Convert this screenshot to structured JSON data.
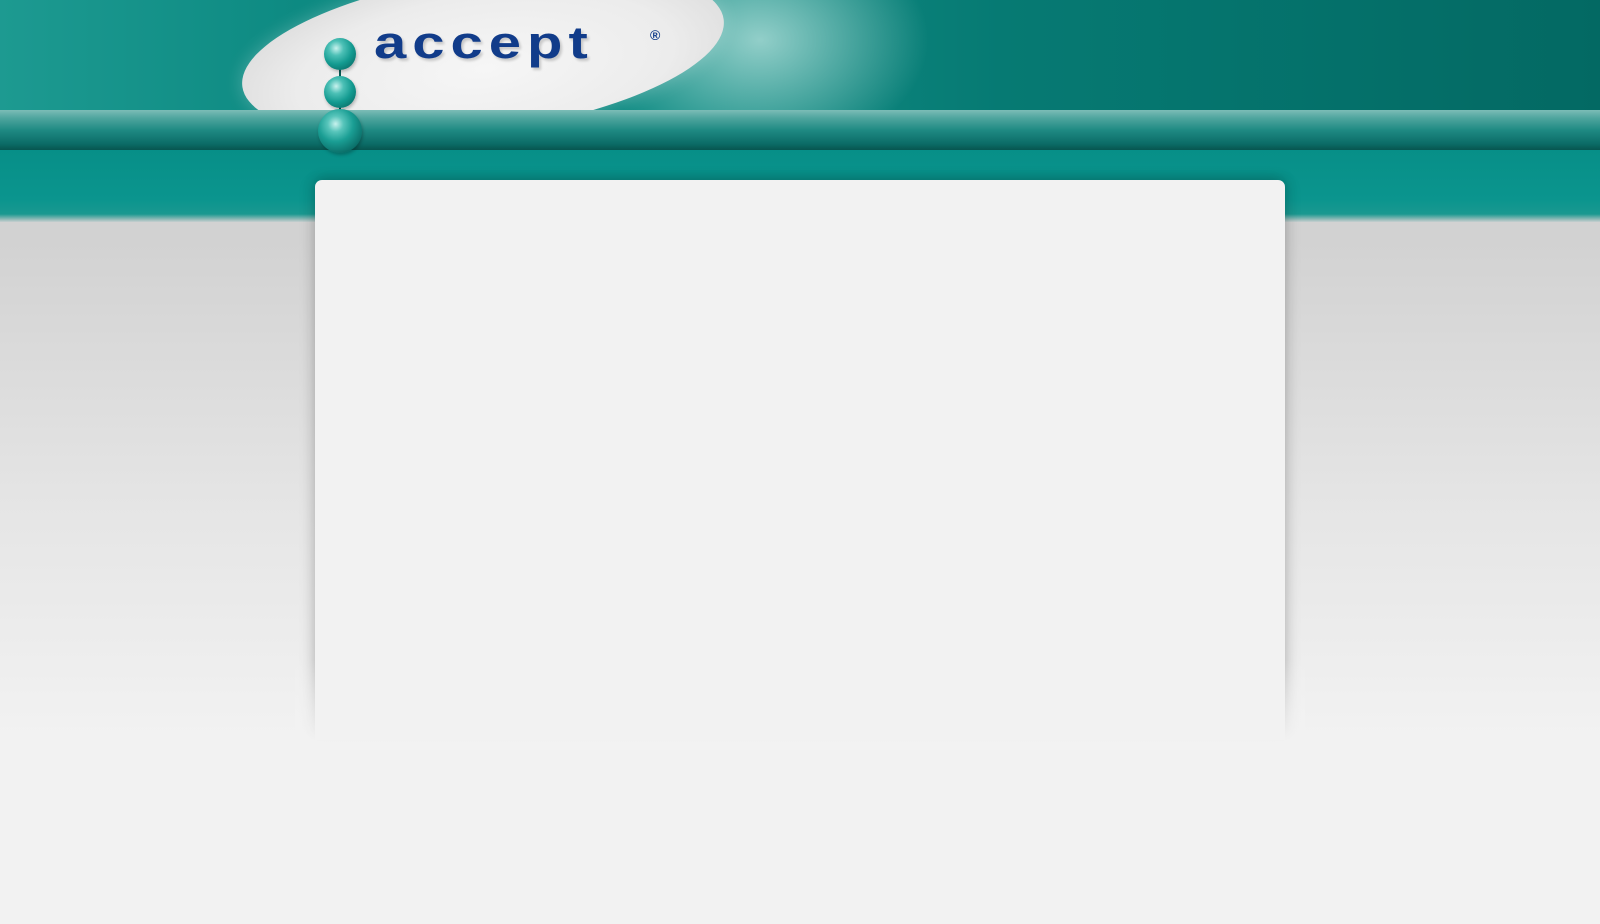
{
  "brand": {
    "name": "accept",
    "registered_mark": "®",
    "colors": {
      "primary_teal": "#0d8a82",
      "dark_teal": "#036963",
      "logo_blue": "#113c8a",
      "page_gray": "#f2f2f2"
    }
  },
  "content": {
    "panel_text": ""
  }
}
